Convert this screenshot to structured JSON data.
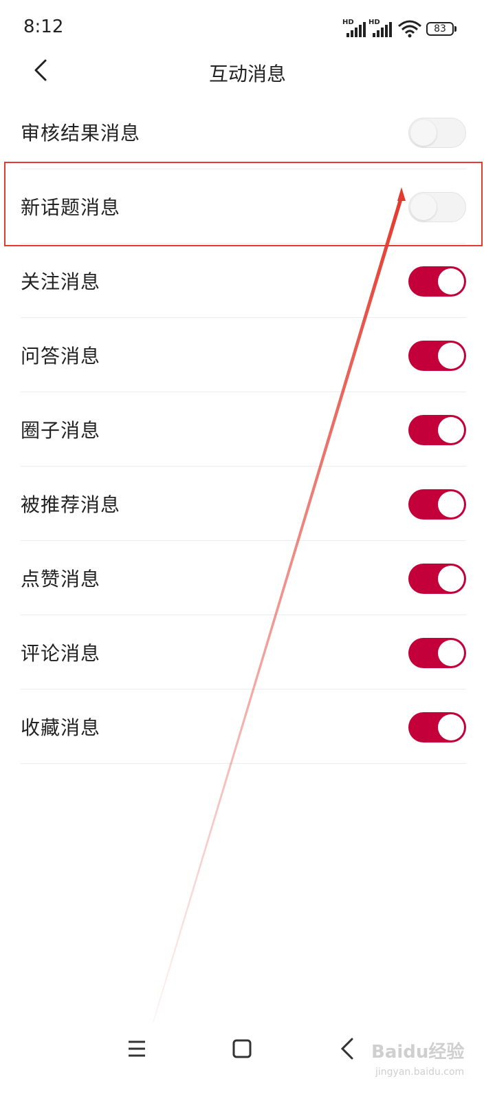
{
  "status_bar": {
    "time": "8:12",
    "signal_1_label": "HD",
    "signal_2_label": "HD",
    "wifi_icon": "wifi-icon",
    "battery": "83"
  },
  "header": {
    "title": "互动消息",
    "back_icon": "chevron-left-icon"
  },
  "settings": [
    {
      "label": "审核结果消息",
      "enabled": false
    },
    {
      "label": "新话题消息",
      "enabled": false
    },
    {
      "label": "关注消息",
      "enabled": true
    },
    {
      "label": "问答消息",
      "enabled": true
    },
    {
      "label": "圈子消息",
      "enabled": true
    },
    {
      "label": "被推荐消息",
      "enabled": true
    },
    {
      "label": "点赞消息",
      "enabled": true
    },
    {
      "label": "评论消息",
      "enabled": true
    },
    {
      "label": "收藏消息",
      "enabled": true
    }
  ],
  "colors": {
    "accent": "#c4003a",
    "annotation": "#e23a2e"
  },
  "nav_bar": {
    "menu_icon": "menu-icon",
    "home_icon": "home-icon",
    "back_icon": "back-icon"
  },
  "watermark": {
    "text": "Baidu经验",
    "url_text": "jingyan.baidu.com"
  }
}
